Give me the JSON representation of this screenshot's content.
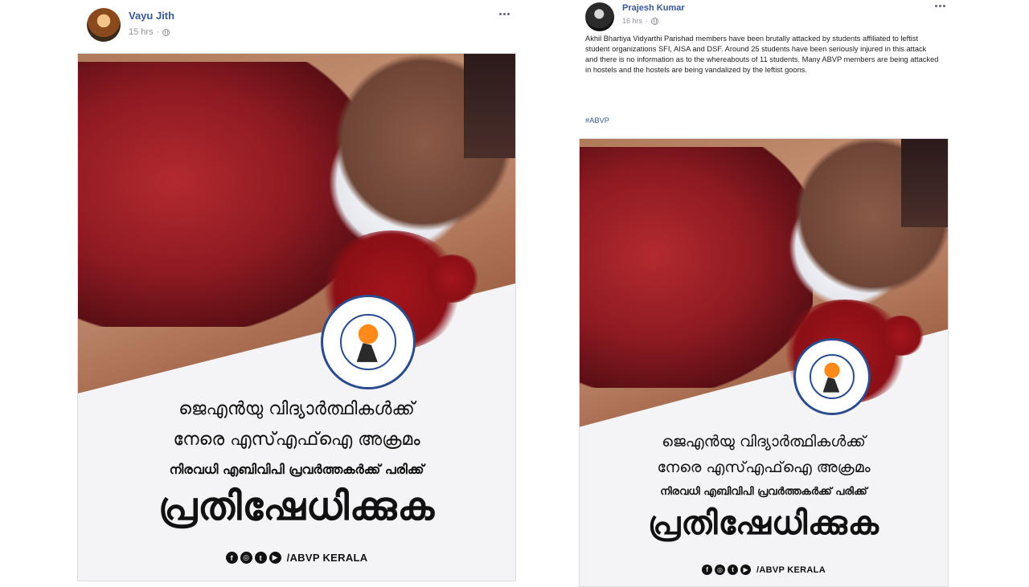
{
  "posts": [
    {
      "author": "Vayu Jith",
      "time": "15 hrs",
      "separator": "·",
      "caption": "",
      "hashtag": "",
      "poster": {
        "line1": "ജെഎൻയു വിദ്യാർത്ഥികൾക്ക്",
        "line2": "നേരെ എസ്എഫ്ഐ   അക്രമം",
        "line3": "നിരവധി എബിവിപി പ്രവർത്തകർക്ക് പരിക്ക്",
        "line4": "പ്രതിഷേധിക്കുക",
        "social_handle": "/ABVP KERALA",
        "social_icons": [
          "facebook-icon",
          "instagram-icon",
          "twitter-icon",
          "youtube-icon"
        ]
      }
    },
    {
      "author": "Prajesh Kumar",
      "time": "16 hrs",
      "separator": "·",
      "caption": "Akhil Bhartiya Vidyarthi Parishad members have been brutally attacked by students affiliated to leftist student organizations SFI, AISA and DSF. Around 25 students have been seriously injured in this attack and there is no information as to the whereabouts of 11 students. Many ABVP members are being attacked in hostels and the hostels are being vandalized by the leftist goons.",
      "hashtag": "#ABVP",
      "poster": {
        "line1": "ജെഎൻയു വിദ്യാർത്ഥികൾക്ക്",
        "line2": "നേരെ എസ്എഫ്ഐ   അക്രമം",
        "line3": "നിരവധി എബിവിപി പ്രവർത്തകർക്ക് പരിക്ക്",
        "line4": "പ്രതിഷേധിക്കുക",
        "social_handle": "/ABVP KERALA",
        "social_icons": [
          "facebook-icon",
          "instagram-icon",
          "twitter-icon",
          "youtube-icon"
        ]
      }
    }
  ],
  "colors": {
    "author_link": "#385898",
    "meta_gray": "#90949c",
    "blood_red": "#8b0f16",
    "logo_blue": "#2a4b8d",
    "logo_orange": "#ff8a1a"
  },
  "icons": {
    "privacy": "globe-icon",
    "menu": "more-options-icon",
    "facebook": "f",
    "instagram": "◎",
    "twitter": "t",
    "youtube": "▶"
  }
}
